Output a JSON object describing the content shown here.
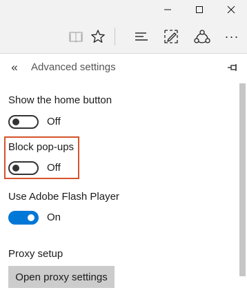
{
  "titlebar": {
    "minimize_icon": "minimize-icon",
    "maximize_icon": "maximize-icon",
    "close_icon": "close-icon"
  },
  "toolbar": {
    "icons": [
      "reading-view-icon",
      "favorite-star-icon",
      "hub-icon",
      "web-note-icon",
      "share-icon",
      "more-icon"
    ],
    "more_label": "···"
  },
  "panel": {
    "back_label": "«",
    "title": "Advanced settings",
    "pin_icon": "pin-icon"
  },
  "settings": {
    "home_button": {
      "label": "Show the home button",
      "state": "Off"
    },
    "popups": {
      "label": "Block pop-ups",
      "state": "Off"
    },
    "flash": {
      "label": "Use Adobe Flash Player",
      "state": "On"
    },
    "proxy": {
      "label": "Proxy setup",
      "button_label": "Open proxy settings"
    }
  },
  "colors": {
    "accent": "#0078d7",
    "highlight": "#d4532a",
    "chrome": "#f2f2f2",
    "button": "#cccccc"
  }
}
